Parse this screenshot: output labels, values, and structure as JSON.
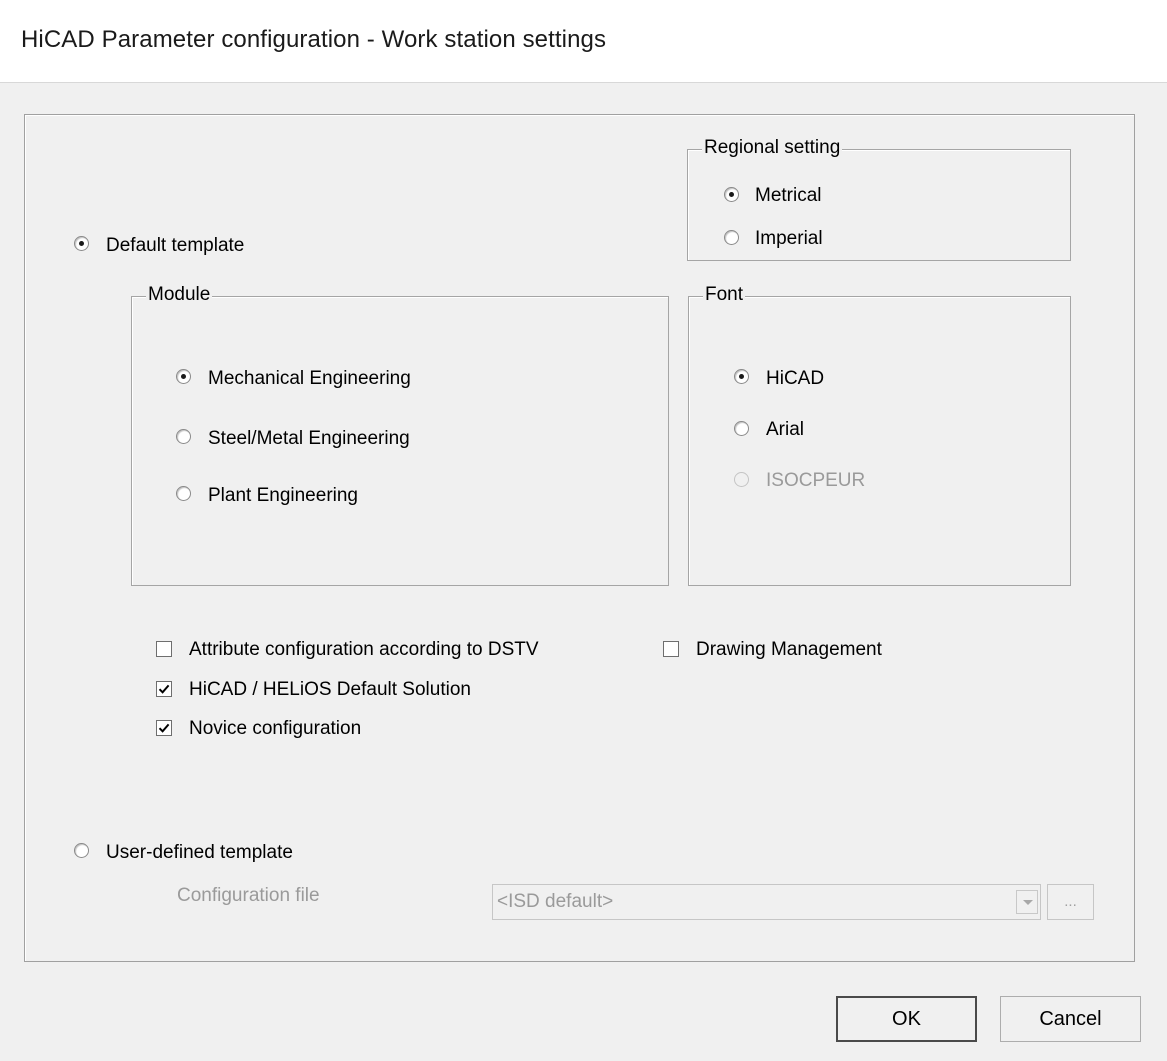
{
  "window": {
    "title": "HiCAD Parameter configuration - Work station settings"
  },
  "template_choice": {
    "default_label": "Default template",
    "user_defined_label": "User-defined template",
    "selected": "default"
  },
  "regional_setting": {
    "label": "Regional setting",
    "options": [
      {
        "label": "Metrical",
        "checked": true
      },
      {
        "label": "Imperial",
        "checked": false
      }
    ]
  },
  "module": {
    "label": "Module",
    "options": [
      {
        "label": "Mechanical Engineering",
        "checked": true
      },
      {
        "label": "Steel/Metal Engineering",
        "checked": false
      },
      {
        "label": "Plant Engineering",
        "checked": false
      }
    ]
  },
  "font": {
    "label": "Font",
    "options": [
      {
        "label": "HiCAD",
        "checked": true,
        "enabled": true
      },
      {
        "label": "Arial",
        "checked": false,
        "enabled": true
      },
      {
        "label": "ISOCPEUR",
        "checked": false,
        "enabled": false
      }
    ]
  },
  "checkboxes": [
    {
      "label": "Attribute configuration according to DSTV",
      "checked": false
    },
    {
      "label": "HiCAD / HELiOS Default Solution",
      "checked": true
    },
    {
      "label": "Novice configuration",
      "checked": true
    },
    {
      "label": "Drawing Management",
      "checked": false
    }
  ],
  "config_file": {
    "label": "Configuration file",
    "value": "<ISD default>",
    "browse_label": "..."
  },
  "buttons": {
    "ok": "OK",
    "cancel": "Cancel"
  }
}
